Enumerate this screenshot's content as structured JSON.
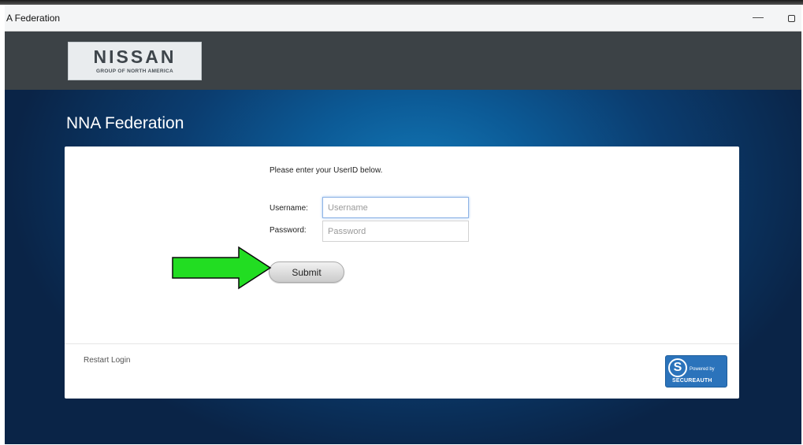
{
  "window": {
    "title": "A Federation",
    "minimize_glyph": "—"
  },
  "header": {
    "logo": {
      "brand": "NISSAN",
      "tagline": "GROUP OF NORTH AMERICA"
    }
  },
  "page": {
    "heading": "NNA Federation"
  },
  "login": {
    "prompt": "Please enter your UserID below.",
    "username_label": "Username:",
    "username_placeholder": "Username",
    "password_label": "Password:",
    "password_placeholder": "Password",
    "submit_label": "Submit",
    "restart_label": "Restart Login"
  },
  "badge": {
    "icon_letter": "S",
    "powered_by": "Powered by",
    "vendor": "SECUREAUTH"
  },
  "annotation": {
    "arrow_color": "#22dd22",
    "points_to": "submit-button"
  },
  "colors": {
    "header_band": "#3c4246",
    "background_blue": "#0c5a96",
    "badge_blue": "#2b73bb"
  }
}
